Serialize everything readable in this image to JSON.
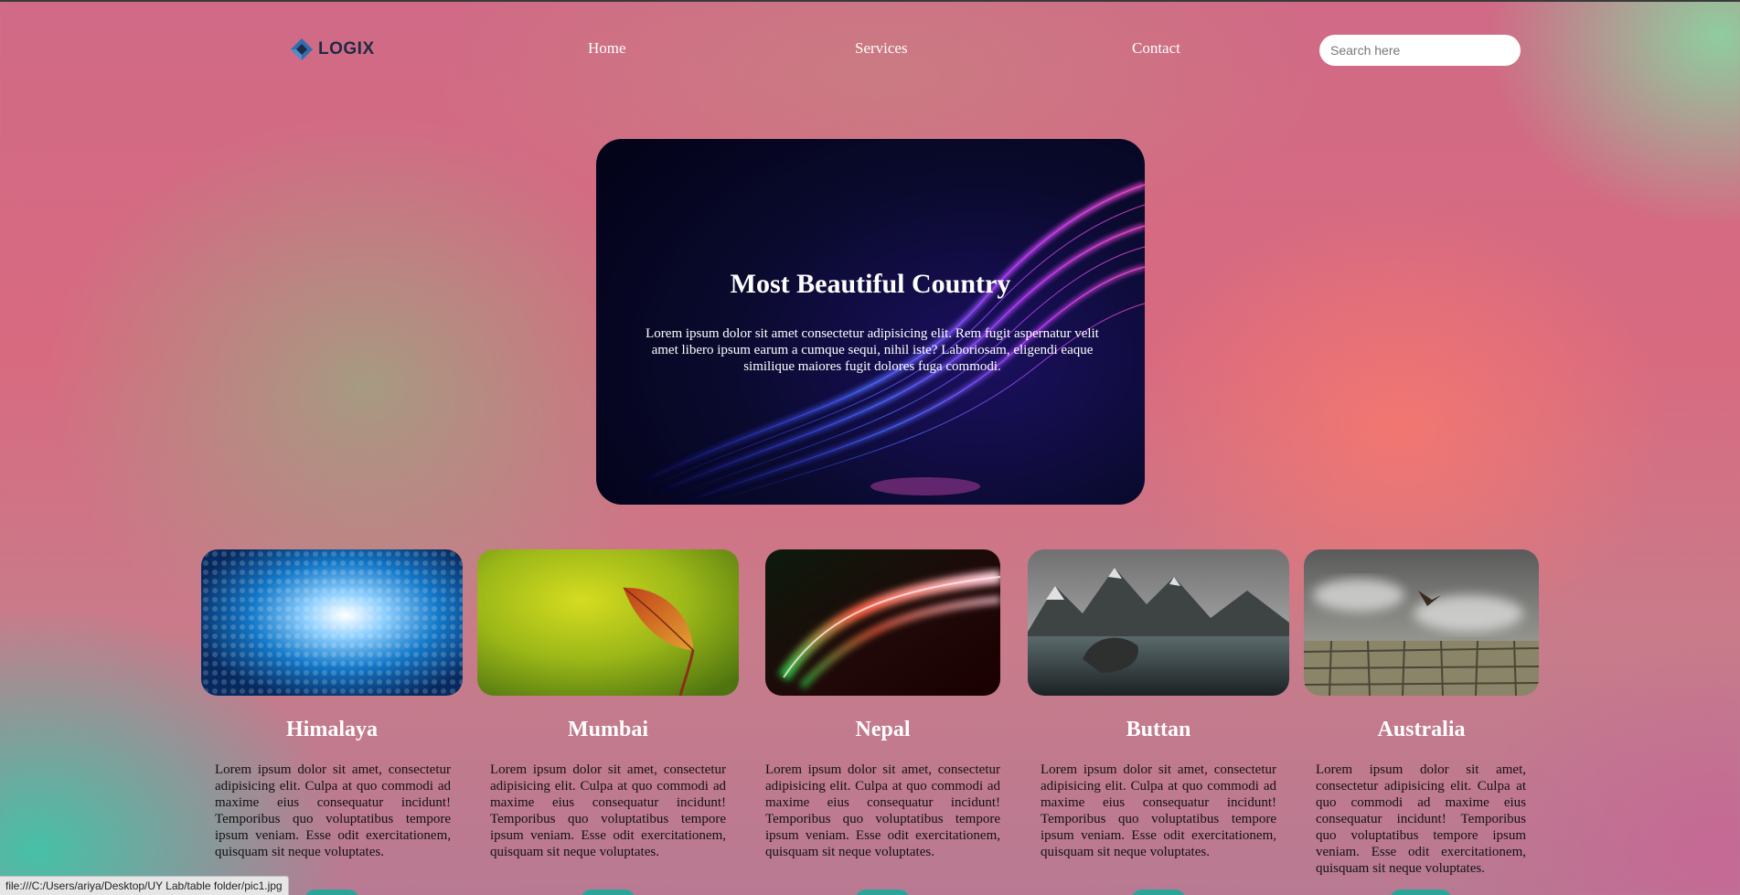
{
  "nav": {
    "logo_text": "LOGIX",
    "links": {
      "home": "Home",
      "services": "Services",
      "contact": "Contact"
    },
    "search_placeholder": "Search here"
  },
  "hero": {
    "title": "Most Beautiful Country",
    "text": "Lorem ipsum dolor sit amet consectetur adipisicing elit. Rem fugit aspernatur velit amet libero ipsum earum a cumque sequi, nihil iste? Laboriosam, eligendi eaque similique maiores fugit dolores fuga commodi."
  },
  "cards": [
    {
      "title": "Himalaya",
      "text": "Lorem ipsum dolor sit amet, consectetur adipisicing elit. Culpa at quo commodi ad maxime eius consequatur incidunt! Temporibus quo voluptatibus tempore ipsum veniam. Esse odit exercitationem, quisquam sit neque voluptates."
    },
    {
      "title": "Mumbai",
      "text": "Lorem ipsum dolor sit amet, consectetur adipisicing elit. Culpa at quo commodi ad maxime eius consequatur incidunt! Temporibus quo voluptatibus tempore ipsum veniam. Esse odit exercitationem, quisquam sit neque voluptates."
    },
    {
      "title": "Nepal",
      "text": "Lorem ipsum dolor sit amet, consectetur adipisicing elit. Culpa at quo commodi ad maxime eius consequatur incidunt! Temporibus quo voluptatibus tempore ipsum veniam. Esse odit exercitationem, quisquam sit neque voluptates."
    },
    {
      "title": "Buttan",
      "text": "Lorem ipsum dolor sit amet, consectetur adipisicing elit. Culpa at quo commodi ad maxime eius consequatur incidunt! Temporibus quo voluptatibus tempore ipsum veniam. Esse odit exercitationem, quisquam sit neque voluptates."
    },
    {
      "title": "Australia",
      "text": "Lorem ipsum dolor sit amet, consectetur adipisicing elit. Culpa at quo commodi ad maxime eius consequatur incidunt! Temporibus quo voluptatibus tempore ipsum veniam. Esse odit exercitationem, quisquam sit neque voluptates."
    }
  ],
  "status_bar": {
    "url": "file:///C:/Users/ariya/Desktop/UY Lab/table folder/pic1.jpg"
  },
  "colors": {
    "accent_button": "#2aa59a",
    "nav_text": "#ffffff",
    "logo_text": "#1f2a44",
    "logo_mark": "#2f6fb0"
  },
  "icons": {
    "logo": "logix-diamond-logo"
  }
}
